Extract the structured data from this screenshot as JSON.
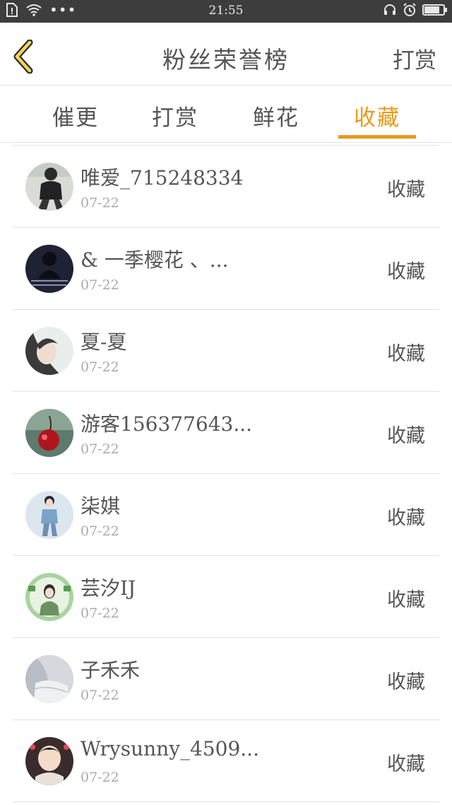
{
  "status_bar": {
    "time": "21:55",
    "battery_level": 0.8
  },
  "header": {
    "title": "粉丝荣誉榜",
    "action": "打赏"
  },
  "tabs": [
    {
      "label": "催更",
      "active": false
    },
    {
      "label": "打赏",
      "active": false
    },
    {
      "label": "鲜花",
      "active": false
    },
    {
      "label": "收藏",
      "active": true
    }
  ],
  "accent_color": "#e99a1b",
  "rows": [
    {
      "name": "唯爱_715248334",
      "date": "07-22",
      "action": "收藏"
    },
    {
      "name": "& 一季樱花 、...",
      "date": "07-22",
      "action": "收藏"
    },
    {
      "name": "夏-夏",
      "date": "07-22",
      "action": "收藏"
    },
    {
      "name": "游客156377643...",
      "date": "07-22",
      "action": "收藏"
    },
    {
      "name": "柒娸",
      "date": "07-22",
      "action": "收藏"
    },
    {
      "name": "芸汐IJ",
      "date": "07-22",
      "action": "收藏"
    },
    {
      "name": "子禾禾",
      "date": "07-22",
      "action": "收藏"
    },
    {
      "name": "Wrysunny_4509...",
      "date": "07-22",
      "action": "收藏"
    }
  ]
}
